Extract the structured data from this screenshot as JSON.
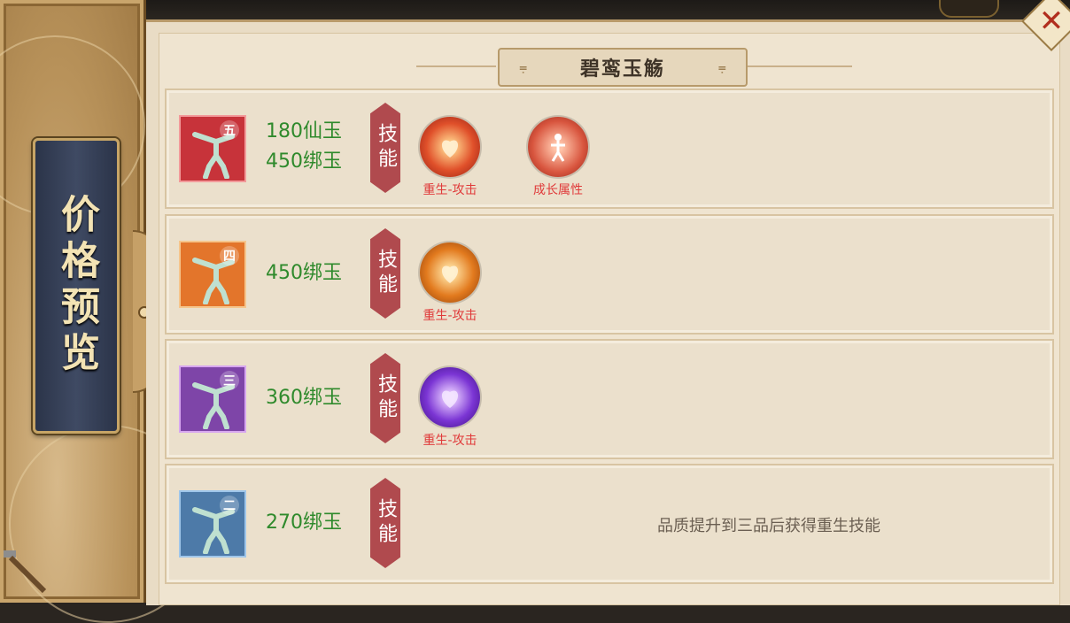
{
  "panel": {
    "side_title": "价格预览",
    "header_title": "碧鸾玉觞",
    "skill_tag_label": "技能"
  },
  "rows": [
    {
      "grade": "五",
      "grade_color": "#d9333a",
      "prices": [
        "180仙玉",
        "450绑玉"
      ],
      "skills": [
        {
          "label": "重生-攻击",
          "icon": "phoenix-rebirth-icon",
          "color": "#d84423"
        },
        {
          "label": "成长属性",
          "icon": "growth-attribute-icon",
          "color": "#d0533c"
        }
      ]
    },
    {
      "grade": "四",
      "grade_color": "#e3752b",
      "prices": [
        "450绑玉"
      ],
      "skills": [
        {
          "label": "重生-攻击",
          "icon": "phoenix-rebirth-icon",
          "color": "#e0701c"
        }
      ]
    },
    {
      "grade": "三",
      "grade_color": "#8a46b8",
      "prices": [
        "360绑玉"
      ],
      "skills": [
        {
          "label": "重生-攻击",
          "icon": "phoenix-rebirth-icon",
          "color": "#7b35d4"
        }
      ]
    },
    {
      "grade": "二",
      "grade_color": "#3f79b0",
      "prices": [
        "270绑玉"
      ],
      "skills": [],
      "hint": "品质提升到三品后获得重生技能"
    }
  ],
  "top_background": {
    "visible_text": ""
  }
}
